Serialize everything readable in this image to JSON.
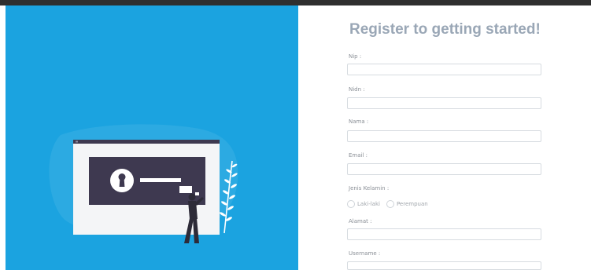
{
  "hero": {
    "background_color": "#1ba3e0",
    "illustration": "lock-screen-illustration"
  },
  "form": {
    "title": "Register to getting started!",
    "fields": {
      "nip": {
        "label": "Nip :",
        "value": "",
        "placeholder": ""
      },
      "nidn": {
        "label": "Nidn :",
        "value": "",
        "placeholder": ""
      },
      "nama": {
        "label": "Nama :",
        "value": "",
        "placeholder": ""
      },
      "email": {
        "label": "Email :",
        "value": "",
        "placeholder": ""
      },
      "alamat": {
        "label": "Alamat :",
        "value": "",
        "placeholder": ""
      },
      "username": {
        "label": "Username :",
        "value": "",
        "placeholder": ""
      }
    },
    "jenis_kelamin": {
      "label": "Jenis Kelamin :",
      "options": [
        "Laki-laki",
        "Perempuan"
      ]
    }
  }
}
